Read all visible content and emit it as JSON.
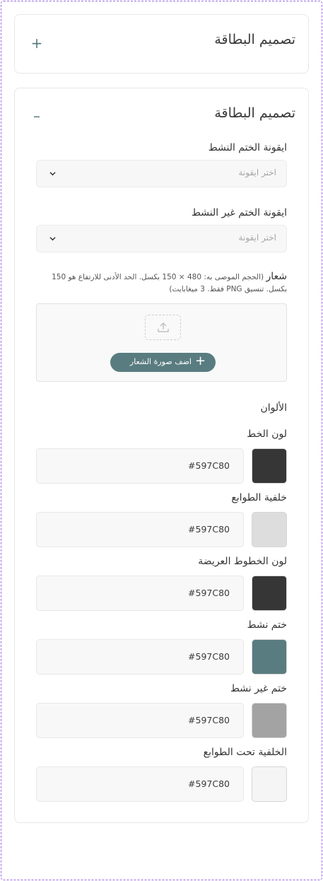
{
  "collapsed_card": {
    "title": "تصميم البطاقة",
    "toggle": "+"
  },
  "card": {
    "title": "تصميم البطاقة",
    "toggle": "–",
    "active_icon": {
      "label": "ايقونة الختم النشط",
      "placeholder": "اختر ايقونة"
    },
    "inactive_icon": {
      "label": "ايقونة الختم غير النشط",
      "placeholder": "اختر ايقونة"
    },
    "logo": {
      "label": "شعار",
      "hint": "(الحجم الموصى به: 480 × 150 بكسل. الحد الأدنى للارتفاع هو 150 بكسل. تنسيق PNG فقط. 3 ميغابايت)",
      "button": "اضف صورة الشعار"
    },
    "colors_title": "الألوان",
    "colors": [
      {
        "label": "لون الخط",
        "value": "#597C80",
        "swatch": "#363636"
      },
      {
        "label": "خلفية الطوابع",
        "value": "#597C80",
        "swatch": "#dddddd"
      },
      {
        "label": "لون الخطوط العريضة",
        "value": "#597C80",
        "swatch": "#363636"
      },
      {
        "label": "ختم نشط",
        "value": "#597C80",
        "swatch": "#597c80"
      },
      {
        "label": "ختم غير نشط",
        "value": "#597C80",
        "swatch": "#a3a3a3"
      },
      {
        "label": "الخلفية تحت الطوابع",
        "value": "#597C80",
        "swatch": "#f5f5f6"
      }
    ]
  }
}
